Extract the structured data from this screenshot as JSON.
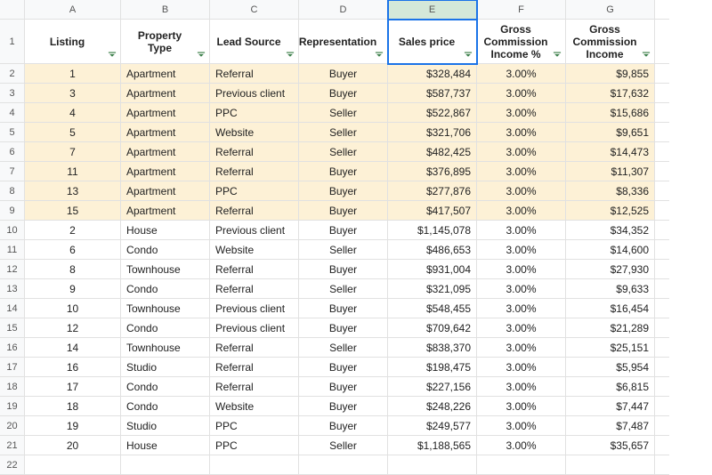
{
  "columns": [
    "A",
    "B",
    "C",
    "D",
    "E",
    "F",
    "G"
  ],
  "selected_column": "E",
  "header_row_num": "1",
  "headers": {
    "A": "Listing",
    "B": "Property Type",
    "C": "Lead Source",
    "D": "Representation",
    "E": "Sales price",
    "F": "Gross Commission Income %",
    "G": "Gross Commission Income"
  },
  "rows": [
    {
      "num": "2",
      "hl": true,
      "A": "1",
      "B": "Apartment",
      "C": "Referral",
      "D": "Buyer",
      "E": "$328,484",
      "F": "3.00%",
      "G": "$9,855"
    },
    {
      "num": "3",
      "hl": true,
      "A": "3",
      "B": "Apartment",
      "C": "Previous client",
      "D": "Buyer",
      "E": "$587,737",
      "F": "3.00%",
      "G": "$17,632"
    },
    {
      "num": "4",
      "hl": true,
      "A": "4",
      "B": "Apartment",
      "C": "PPC",
      "D": "Seller",
      "E": "$522,867",
      "F": "3.00%",
      "G": "$15,686"
    },
    {
      "num": "5",
      "hl": true,
      "A": "5",
      "B": "Apartment",
      "C": "Website",
      "D": "Seller",
      "E": "$321,706",
      "F": "3.00%",
      "G": "$9,651"
    },
    {
      "num": "6",
      "hl": true,
      "A": "7",
      "B": "Apartment",
      "C": "Referral",
      "D": "Seller",
      "E": "$482,425",
      "F": "3.00%",
      "G": "$14,473"
    },
    {
      "num": "7",
      "hl": true,
      "A": "11",
      "B": "Apartment",
      "C": "Referral",
      "D": "Buyer",
      "E": "$376,895",
      "F": "3.00%",
      "G": "$11,307"
    },
    {
      "num": "8",
      "hl": true,
      "A": "13",
      "B": "Apartment",
      "C": "PPC",
      "D": "Buyer",
      "E": "$277,876",
      "F": "3.00%",
      "G": "$8,336"
    },
    {
      "num": "9",
      "hl": true,
      "A": "15",
      "B": "Apartment",
      "C": "Referral",
      "D": "Buyer",
      "E": "$417,507",
      "F": "3.00%",
      "G": "$12,525"
    },
    {
      "num": "10",
      "hl": false,
      "A": "2",
      "B": "House",
      "C": "Previous client",
      "D": "Buyer",
      "E": "$1,145,078",
      "F": "3.00%",
      "G": "$34,352"
    },
    {
      "num": "11",
      "hl": false,
      "A": "6",
      "B": "Condo",
      "C": "Website",
      "D": "Seller",
      "E": "$486,653",
      "F": "3.00%",
      "G": "$14,600"
    },
    {
      "num": "12",
      "hl": false,
      "A": "8",
      "B": "Townhouse",
      "C": "Referral",
      "D": "Buyer",
      "E": "$931,004",
      "F": "3.00%",
      "G": "$27,930"
    },
    {
      "num": "13",
      "hl": false,
      "A": "9",
      "B": "Condo",
      "C": "Referral",
      "D": "Seller",
      "E": "$321,095",
      "F": "3.00%",
      "G": "$9,633"
    },
    {
      "num": "14",
      "hl": false,
      "A": "10",
      "B": "Townhouse",
      "C": "Previous client",
      "D": "Buyer",
      "E": "$548,455",
      "F": "3.00%",
      "G": "$16,454"
    },
    {
      "num": "15",
      "hl": false,
      "A": "12",
      "B": "Condo",
      "C": "Previous client",
      "D": "Buyer",
      "E": "$709,642",
      "F": "3.00%",
      "G": "$21,289"
    },
    {
      "num": "16",
      "hl": false,
      "A": "14",
      "B": "Townhouse",
      "C": "Referral",
      "D": "Seller",
      "E": "$838,370",
      "F": "3.00%",
      "G": "$25,151"
    },
    {
      "num": "17",
      "hl": false,
      "A": "16",
      "B": "Studio",
      "C": "Referral",
      "D": "Buyer",
      "E": "$198,475",
      "F": "3.00%",
      "G": "$5,954"
    },
    {
      "num": "18",
      "hl": false,
      "A": "17",
      "B": "Condo",
      "C": "Referral",
      "D": "Buyer",
      "E": "$227,156",
      "F": "3.00%",
      "G": "$6,815"
    },
    {
      "num": "19",
      "hl": false,
      "A": "18",
      "B": "Condo",
      "C": "Website",
      "D": "Buyer",
      "E": "$248,226",
      "F": "3.00%",
      "G": "$7,447"
    },
    {
      "num": "20",
      "hl": false,
      "A": "19",
      "B": "Studio",
      "C": "PPC",
      "D": "Buyer",
      "E": "$249,577",
      "F": "3.00%",
      "G": "$7,487"
    },
    {
      "num": "21",
      "hl": false,
      "A": "20",
      "B": "House",
      "C": "PPC",
      "D": "Seller",
      "E": "$1,188,565",
      "F": "3.00%",
      "G": "$35,657"
    }
  ],
  "empty_row_num": "22",
  "selected_cell": "E1",
  "align": {
    "A": "center",
    "B": "left",
    "C": "left",
    "D": "center",
    "E": "right",
    "F": "center",
    "G": "right"
  },
  "header_align": {
    "A": "center",
    "B": "center",
    "C": "center",
    "D": "center",
    "E": "center",
    "F": "center",
    "G": "center"
  }
}
